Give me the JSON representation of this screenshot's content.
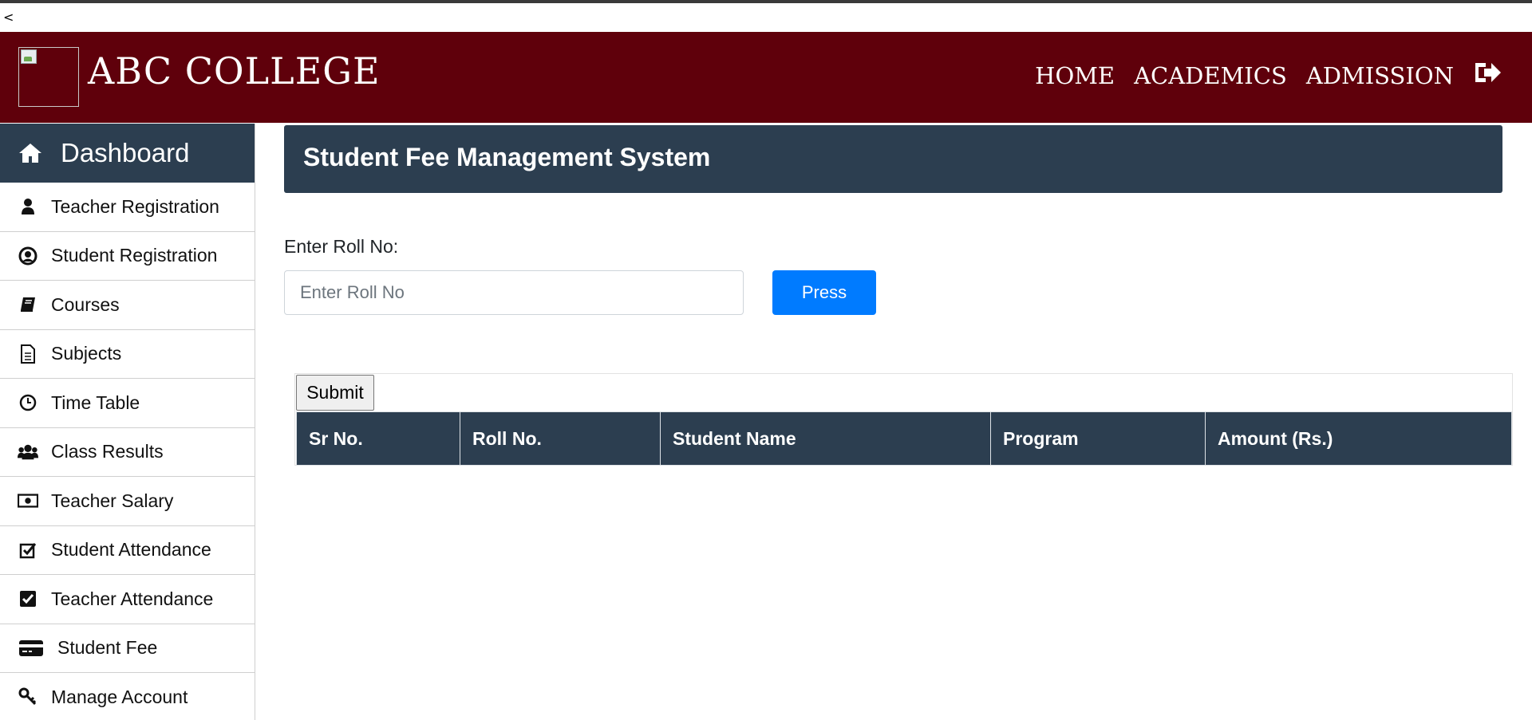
{
  "browser": {
    "back_glyph": "<"
  },
  "header": {
    "college_name": "ABC COLLEGE",
    "nav": [
      "HOME",
      "ACADEMICS",
      "ADMISSION"
    ],
    "logout_icon": "sign-out-icon",
    "background": "#5f000b"
  },
  "sidebar": {
    "dashboard_label": "Dashboard",
    "items": [
      {
        "label": "Teacher Registration",
        "icon": "user-icon"
      },
      {
        "label": "Student Registration",
        "icon": "user-circle-icon"
      },
      {
        "label": "Courses",
        "icon": "book-icon"
      },
      {
        "label": "Subjects",
        "icon": "file-text-icon"
      },
      {
        "label": "Time Table",
        "icon": "clock-icon"
      },
      {
        "label": "Class Results",
        "icon": "users-icon"
      },
      {
        "label": "Teacher Salary",
        "icon": "money-icon"
      },
      {
        "label": "Student Attendance",
        "icon": "check-square-icon"
      },
      {
        "label": "Teacher Attendance",
        "icon": "check-square-filled-icon"
      },
      {
        "label": "Student Fee",
        "icon": "credit-card-icon"
      },
      {
        "label": "Manage Account",
        "icon": "key-icon"
      }
    ]
  },
  "main": {
    "title": "Student Fee Management System",
    "roll_label": "Enter Roll No:",
    "roll_placeholder": "Enter Roll No",
    "roll_value": "",
    "press_label": "Press",
    "submit_label": "Submit",
    "table_headers": [
      "Sr No.",
      "Roll No.",
      "Student Name",
      "Program",
      "Amount (Rs.)"
    ]
  },
  "colors": {
    "panel": "#2c3e50",
    "primary": "#007bff"
  }
}
